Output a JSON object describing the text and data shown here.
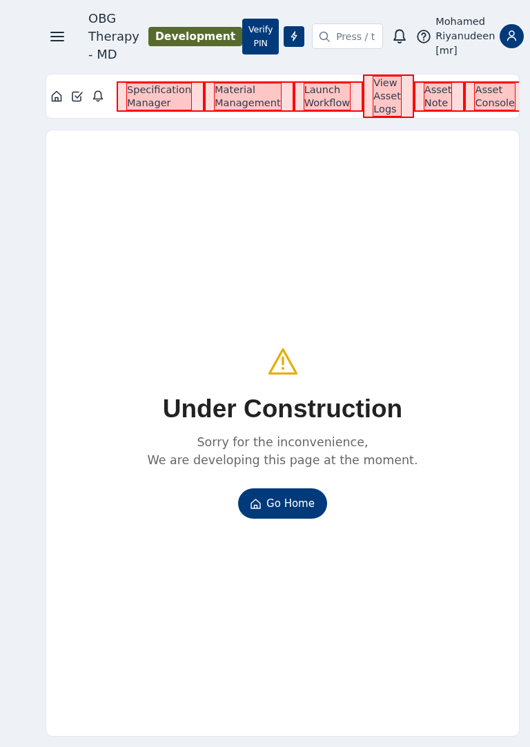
{
  "header": {
    "title": "OBG Therapy - MD",
    "environment_badge": "Development",
    "verify_pin_button": "Verify PIN",
    "search": {
      "placeholder": "Press / t"
    },
    "user_name": "Mohamed Riyanudeen [mr]"
  },
  "nav": {
    "items": [
      {
        "label": "Specification Manager"
      },
      {
        "label": "Material Management"
      },
      {
        "label": "Launch Workflow"
      },
      {
        "label": "View Asset Logs"
      },
      {
        "label": "Asset Note"
      },
      {
        "label": "Asset Console"
      }
    ]
  },
  "content": {
    "title": "Under Construction",
    "message_lines": [
      "Sorry for the inconvenience,",
      "We are developing this page at the moment."
    ],
    "button": "Go Home"
  }
}
